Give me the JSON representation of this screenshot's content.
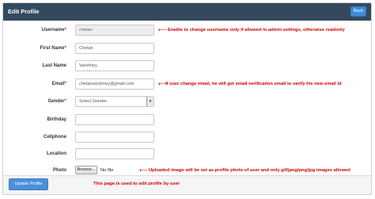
{
  "header": {
    "title": "Edit Profile",
    "back_label": "Back"
  },
  "form": {
    "username": {
      "label": "Username",
      "required": "*",
      "value": "chetan"
    },
    "first_name": {
      "label": "First Name",
      "required": "*",
      "value": "Chetan"
    },
    "last_name": {
      "label": "Last Name",
      "value": "Varshney"
    },
    "email": {
      "label": "Email",
      "required": "*",
      "value": "chetanvarshney@gmail.com"
    },
    "gender": {
      "label": "Gender",
      "required": "*",
      "selected": "Select Gender"
    },
    "birthday": {
      "label": "Birthday",
      "value": ""
    },
    "cellphone": {
      "label": "Cellphone",
      "value": ""
    },
    "location": {
      "label": "Location",
      "value": ""
    },
    "photo": {
      "label": "Photo",
      "browse_label": "Browse...",
      "file_status": "No file selected."
    }
  },
  "annotations": {
    "username": "Enable to change username only if allowed in admin settings, otherwise readonly",
    "email": "If user change email, he will get email verification email to varify his new email id",
    "photo": "Uploaded image will be set as profile photo of user and only gif/jpeg/png/jpg images allowed",
    "footer": "This page is used to edit profile by user"
  },
  "footer": {
    "update_label": "Update Profile"
  },
  "colors": {
    "header_bg": "#34495e",
    "primary_button": "#4a90d9",
    "annotation_red": "#d40000"
  },
  "icons": {
    "annotation_arrow": "left-arrow-icon",
    "select_caret": "caret-down-icon"
  }
}
